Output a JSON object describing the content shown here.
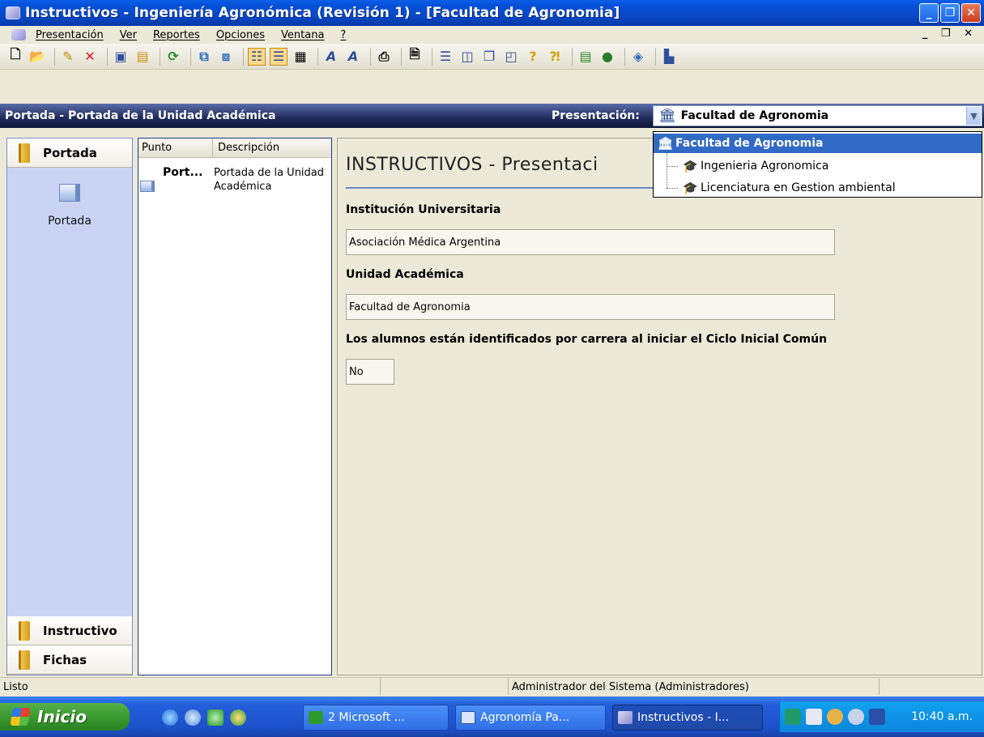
{
  "window": {
    "title": "Instructivos - Ingeniería Agronómica (Revisión 1) - [Facultad de Agronomia]",
    "controls": [
      "_",
      "❐",
      "✕"
    ]
  },
  "menu": {
    "items": [
      "Presentación",
      "Ver",
      "Reportes",
      "Opciones",
      "Ventana",
      "?"
    ],
    "mdi_controls": "_ ❐ ✕"
  },
  "header": {
    "breadcrumb": "Portada - Portada de la Unidad Académica",
    "presentacion_label": "Presentación:",
    "selected_value": "Facultad de Agronomia"
  },
  "dropdown": {
    "options": [
      "Facultad de Agronomia",
      "Ingenieria Agronomica",
      "Licenciatura en Gestion ambiental"
    ]
  },
  "leftnav": {
    "groups": [
      "Portada",
      "Instructivo",
      "Fichas"
    ],
    "portada_item": "Portada"
  },
  "list": {
    "columns": [
      "Punto",
      "Descripción"
    ],
    "rows": [
      {
        "punto": "Port...",
        "descripcion": "Portada de la Unidad Académica"
      }
    ]
  },
  "content": {
    "title": "INSTRUCTIVOS - Presentaci",
    "fields": [
      {
        "label": "Institución Universitaria",
        "value": "Asociación Médica Argentina"
      },
      {
        "label": "Unidad Académica",
        "value": "Facultad de Agronomia"
      },
      {
        "label": "Los alumnos están identificados por carrera al iniciar el Ciclo Inicial Común",
        "value": "No"
      }
    ]
  },
  "statusbar": {
    "status": "Listo",
    "user": "Administrador del Sistema (Administradores)"
  },
  "taskbar": {
    "start": "Inicio",
    "items": [
      "2 Microsoft ...",
      "Agronomía Pa...",
      "Instructivos - I..."
    ],
    "clock": "10:40 a.m."
  },
  "colors": {
    "titlebar": "#0a48c8",
    "header": "#1e2a59",
    "selection": "#316ac5",
    "leftnav": "#c9d4f4"
  }
}
